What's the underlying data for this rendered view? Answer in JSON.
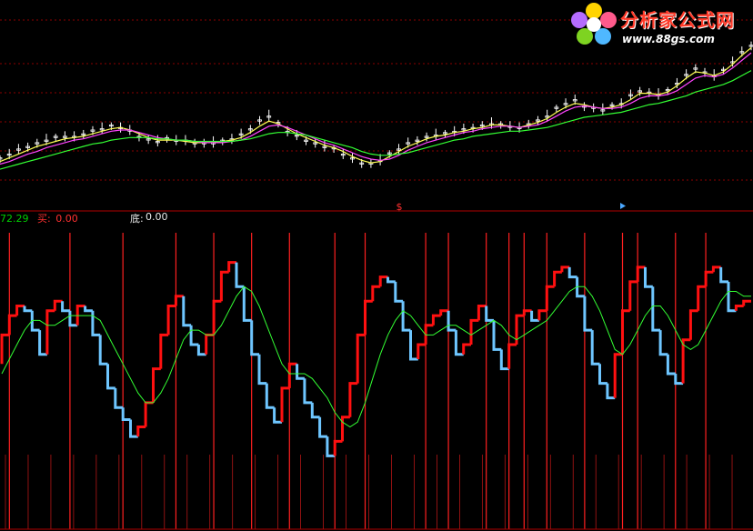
{
  "legend": {
    "value1": "72.29",
    "buy_label": "买:",
    "buy_value": "0.00",
    "bottom_label": "底:",
    "bottom_value": "0.00"
  },
  "logo": {
    "text": "分析家公式网",
    "url": "www.88gs.com"
  },
  "marker": "$",
  "colors": {
    "background": "#000000",
    "grid": "#8b0000",
    "price_up": "#ffffff",
    "ma_fast": "#ffff55",
    "ma_mid": "#ff44ff",
    "ma_slow": "#33ff33",
    "osc_rise": "#ff1010",
    "osc_fall": "#6ec6ff",
    "osc_signal": "#33ff33",
    "buy_line": "#ff2020"
  },
  "chart_data": [
    {
      "type": "line",
      "panel": "price",
      "series": [
        {
          "role": "price",
          "values": [
            0.18,
            0.22,
            0.25,
            0.28,
            0.3,
            0.33,
            0.35,
            0.36,
            0.35,
            0.38,
            0.4,
            0.42,
            0.44,
            0.43,
            0.4,
            0.36,
            0.33,
            0.32,
            0.34,
            0.33,
            0.32,
            0.31,
            0.3,
            0.31,
            0.32,
            0.34,
            0.37,
            0.42,
            0.48,
            0.52,
            0.46,
            0.4,
            0.36,
            0.33,
            0.3,
            0.28,
            0.26,
            0.22,
            0.18,
            0.15,
            0.14,
            0.17,
            0.22,
            0.26,
            0.3,
            0.33,
            0.35,
            0.37,
            0.38,
            0.4,
            0.41,
            0.43,
            0.44,
            0.46,
            0.45,
            0.44,
            0.42,
            0.46,
            0.48,
            0.52,
            0.58,
            0.62,
            0.64,
            0.6,
            0.58,
            0.57,
            0.6,
            0.62,
            0.68,
            0.72,
            0.7,
            0.69,
            0.72,
            0.78,
            0.84,
            0.9,
            0.86,
            0.84,
            0.88,
            0.95,
            1.02,
            1.08
          ]
        },
        {
          "role": "ma_fast",
          "values": [
            0.16,
            0.19,
            0.22,
            0.25,
            0.28,
            0.3,
            0.32,
            0.34,
            0.35,
            0.36,
            0.38,
            0.4,
            0.42,
            0.43,
            0.41,
            0.38,
            0.35,
            0.33,
            0.33,
            0.33,
            0.32,
            0.31,
            0.31,
            0.31,
            0.32,
            0.33,
            0.35,
            0.39,
            0.44,
            0.48,
            0.46,
            0.42,
            0.38,
            0.35,
            0.32,
            0.29,
            0.27,
            0.24,
            0.2,
            0.17,
            0.15,
            0.16,
            0.2,
            0.24,
            0.28,
            0.31,
            0.34,
            0.36,
            0.37,
            0.39,
            0.4,
            0.42,
            0.43,
            0.45,
            0.45,
            0.44,
            0.43,
            0.45,
            0.47,
            0.5,
            0.55,
            0.59,
            0.62,
            0.61,
            0.59,
            0.58,
            0.59,
            0.61,
            0.65,
            0.7,
            0.7,
            0.69,
            0.71,
            0.76,
            0.82,
            0.87,
            0.86,
            0.84,
            0.87,
            0.93,
            1.0,
            1.06
          ]
        },
        {
          "role": "ma_mid",
          "values": [
            0.14,
            0.16,
            0.19,
            0.22,
            0.24,
            0.27,
            0.29,
            0.31,
            0.33,
            0.34,
            0.36,
            0.38,
            0.4,
            0.41,
            0.41,
            0.39,
            0.37,
            0.35,
            0.34,
            0.33,
            0.33,
            0.32,
            0.31,
            0.31,
            0.31,
            0.32,
            0.33,
            0.36,
            0.4,
            0.44,
            0.45,
            0.43,
            0.4,
            0.37,
            0.34,
            0.31,
            0.29,
            0.26,
            0.23,
            0.2,
            0.18,
            0.17,
            0.18,
            0.21,
            0.25,
            0.28,
            0.31,
            0.33,
            0.35,
            0.37,
            0.39,
            0.4,
            0.42,
            0.43,
            0.44,
            0.44,
            0.43,
            0.44,
            0.45,
            0.48,
            0.52,
            0.56,
            0.59,
            0.6,
            0.59,
            0.58,
            0.58,
            0.59,
            0.62,
            0.66,
            0.68,
            0.68,
            0.69,
            0.72,
            0.77,
            0.82,
            0.84,
            0.83,
            0.85,
            0.9,
            0.96,
            1.02
          ]
        },
        {
          "role": "ma_slow",
          "values": [
            0.1,
            0.12,
            0.14,
            0.16,
            0.18,
            0.2,
            0.22,
            0.24,
            0.26,
            0.28,
            0.3,
            0.31,
            0.33,
            0.34,
            0.35,
            0.35,
            0.35,
            0.34,
            0.34,
            0.33,
            0.33,
            0.32,
            0.32,
            0.32,
            0.32,
            0.32,
            0.33,
            0.34,
            0.36,
            0.38,
            0.39,
            0.39,
            0.38,
            0.37,
            0.35,
            0.33,
            0.31,
            0.29,
            0.27,
            0.24,
            0.22,
            0.21,
            0.21,
            0.22,
            0.23,
            0.25,
            0.27,
            0.29,
            0.31,
            0.33,
            0.34,
            0.36,
            0.37,
            0.38,
            0.39,
            0.4,
            0.4,
            0.41,
            0.42,
            0.43,
            0.45,
            0.47,
            0.49,
            0.51,
            0.52,
            0.53,
            0.54,
            0.55,
            0.57,
            0.59,
            0.61,
            0.62,
            0.64,
            0.66,
            0.68,
            0.71,
            0.73,
            0.75,
            0.77,
            0.8,
            0.84,
            0.88
          ]
        }
      ]
    },
    {
      "type": "line",
      "panel": "oscillator",
      "ylim": [
        0,
        100
      ],
      "oscillator": [
        48,
        60,
        68,
        72,
        70,
        62,
        52,
        70,
        74,
        70,
        64,
        72,
        70,
        60,
        48,
        38,
        30,
        25,
        18,
        22,
        32,
        46,
        60,
        72,
        76,
        64,
        56,
        52,
        60,
        74,
        86,
        90,
        80,
        66,
        52,
        40,
        30,
        24,
        38,
        48,
        42,
        32,
        26,
        18,
        10,
        16,
        26,
        40,
        60,
        74,
        80,
        84,
        82,
        74,
        62,
        50,
        56,
        64,
        68,
        70,
        62,
        52,
        56,
        66,
        72,
        66,
        54,
        46,
        56,
        68,
        70,
        66,
        70,
        80,
        86,
        88,
        84,
        76,
        62,
        48,
        40,
        34,
        52,
        70,
        82,
        88,
        80,
        62,
        52,
        44,
        40,
        58,
        70,
        80,
        86,
        88,
        82,
        70,
        72,
        74
      ],
      "signal": [
        44,
        50,
        56,
        62,
        66,
        66,
        64,
        64,
        66,
        68,
        68,
        68,
        68,
        66,
        60,
        54,
        48,
        42,
        36,
        32,
        32,
        36,
        42,
        50,
        58,
        62,
        62,
        60,
        60,
        64,
        70,
        76,
        80,
        78,
        72,
        64,
        56,
        48,
        44,
        44,
        44,
        42,
        38,
        34,
        28,
        24,
        22,
        24,
        32,
        42,
        52,
        60,
        66,
        70,
        68,
        64,
        60,
        60,
        62,
        64,
        64,
        62,
        60,
        62,
        64,
        66,
        64,
        60,
        58,
        60,
        62,
        64,
        66,
        70,
        74,
        78,
        80,
        80,
        76,
        70,
        62,
        54,
        52,
        56,
        62,
        68,
        72,
        72,
        68,
        62,
        56,
        54,
        56,
        62,
        68,
        74,
        78,
        78,
        76,
        76
      ],
      "buy_signals": [
        1,
        9,
        16,
        23,
        28,
        33,
        38,
        44,
        48,
        56,
        59,
        64,
        67,
        69,
        72,
        77,
        82,
        84,
        89,
        93
      ]
    }
  ]
}
